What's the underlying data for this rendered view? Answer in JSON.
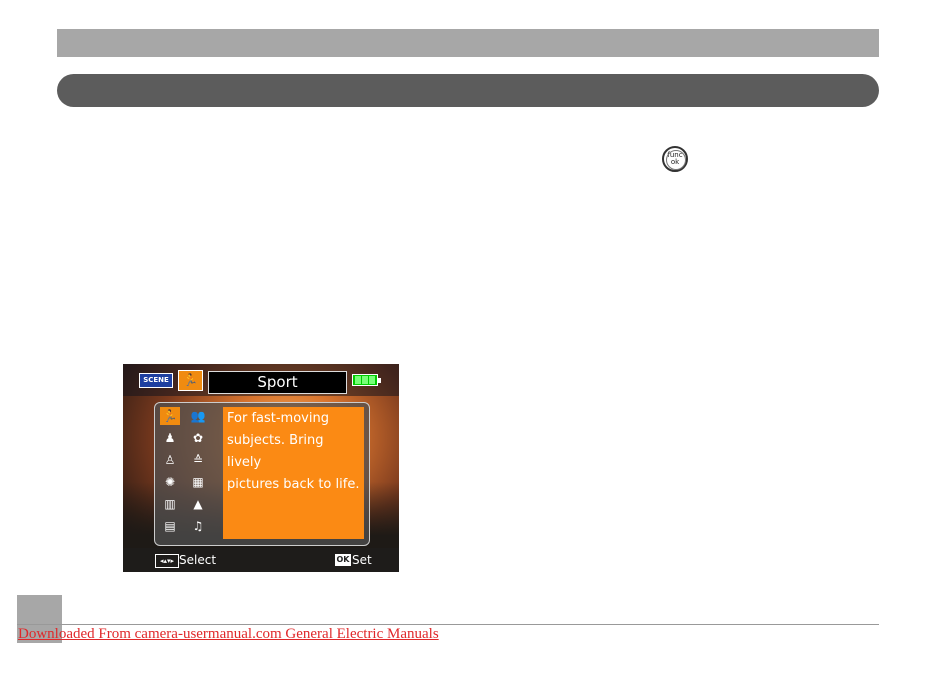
{
  "func_button": {
    "top": "func",
    "bottom": "ok"
  },
  "camera_screen": {
    "scene_badge": "SCENE",
    "mode_title": "Sport",
    "description_lines": [
      "For fast-moving",
      "subjects. Bring lively",
      "pictures back to life."
    ],
    "select_label": "Select",
    "ok_label": "OK",
    "set_label": "Set",
    "icons": [
      {
        "name": "sport-icon",
        "glyph": "🏃"
      },
      {
        "name": "child-icon",
        "glyph": "👥"
      },
      {
        "name": "portrait-icon",
        "glyph": "♟"
      },
      {
        "name": "pet-icon",
        "glyph": "✿"
      },
      {
        "name": "night-portrait-icon",
        "glyph": "♙"
      },
      {
        "name": "sunset-icon",
        "glyph": "≙"
      },
      {
        "name": "fireworks-icon",
        "glyph": "✺"
      },
      {
        "name": "backlight-icon",
        "glyph": "▦"
      },
      {
        "name": "museum-icon",
        "glyph": "▥"
      },
      {
        "name": "landscape-icon",
        "glyph": "▲"
      },
      {
        "name": "text-icon",
        "glyph": "▤"
      },
      {
        "name": "party-icon",
        "glyph": "♫"
      }
    ],
    "accent_color": "#fb8a14"
  },
  "footer": {
    "link_text": "Downloaded From camera-usermanual.com General Electric Manuals",
    "link_color": "#e0282a"
  }
}
